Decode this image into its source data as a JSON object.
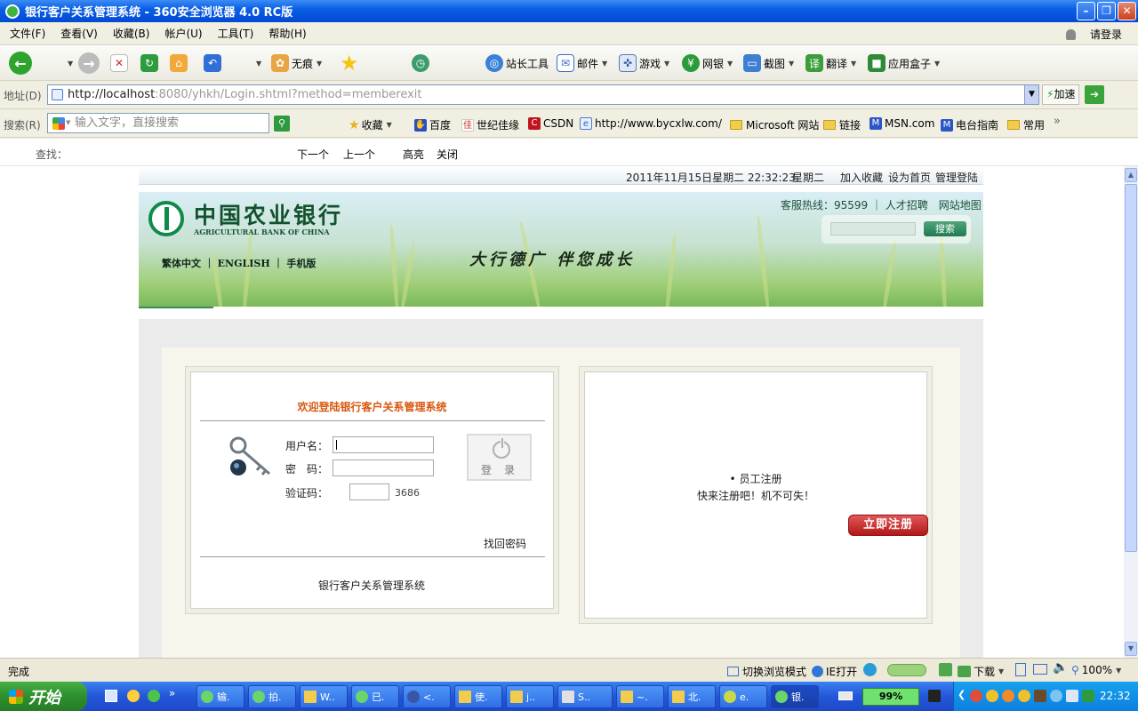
{
  "window": {
    "title": "银行客户关系管理系统 - 360安全浏览器 4.0 RC版"
  },
  "menu": {
    "items": [
      "文件(F)",
      "查看(V)",
      "收藏(B)",
      "帐户(U)",
      "工具(T)",
      "帮助(H)"
    ],
    "login": "请登录"
  },
  "toolbar": {
    "incognito": "无痕",
    "webmaster": "站长工具",
    "mail": "邮件",
    "games": "游戏",
    "netbank": "网银",
    "screenshot": "截图",
    "translate": "翻译",
    "appbox": "应用盒子"
  },
  "address": {
    "label": "地址(D)",
    "url_host": "http://localhost",
    "url_rest": ":8080/yhkh/Login.shtml?method=memberexit",
    "speedup": "加速"
  },
  "search": {
    "label": "搜索(R)",
    "placeholder": "输入文字，直接搜索",
    "favorites": "收藏",
    "fav_items": [
      "百度",
      "世纪佳缘",
      "CSDN",
      "http://www.bycxlw.com/",
      "Microsoft 网站",
      "链接",
      "MSN.com",
      "电台指南",
      "常用"
    ]
  },
  "findbar": {
    "label": "查找：",
    "next": "下一个",
    "prev": "上一个",
    "highlight": "高亮",
    "close": "关闭"
  },
  "page": {
    "datetime": "2011年11月15日星期二 22:32:23",
    "weekday": "星期二",
    "add_fav": "加入收藏",
    "set_home": "设为首页",
    "admin_login": "管理登陆",
    "bank_name_cn": "中国农业银行",
    "bank_name_en": "AGRICULTURAL BANK OF CHINA",
    "lang_links": "繁体中文 ｜ ENGLISH ｜ 手机版",
    "slogan": "大行德广  伴您成长",
    "hotline": "客服热线：95599 ｜ 人才招聘　网站地图",
    "search_btn": "搜索",
    "login": {
      "welcome": "欢迎登陆银行客户关系管理系统",
      "username_label": "用户名：",
      "password_label": "密　码：",
      "captcha_label": "验证码：",
      "captcha_code": "3686",
      "login_btn": "登录",
      "forgot": "找回密码",
      "footer": "银行客户关系管理系统"
    },
    "register": {
      "title": "• 员工注册",
      "subtitle": "快来注册吧！机不可失！",
      "button": "立即注册"
    }
  },
  "status": {
    "text": "完成",
    "switch_mode": "切换浏览模式",
    "ie_open": "IE打开",
    "download": "下载",
    "zoom": "100%"
  },
  "taskbar": {
    "start": "开始",
    "tasks": [
      "输.",
      "拍.",
      "W..",
      "已.",
      "<.",
      "使.",
      "j..",
      "S..",
      "~.",
      "北.",
      "e.",
      "银."
    ],
    "battery": "99%",
    "clock": "22:32"
  }
}
